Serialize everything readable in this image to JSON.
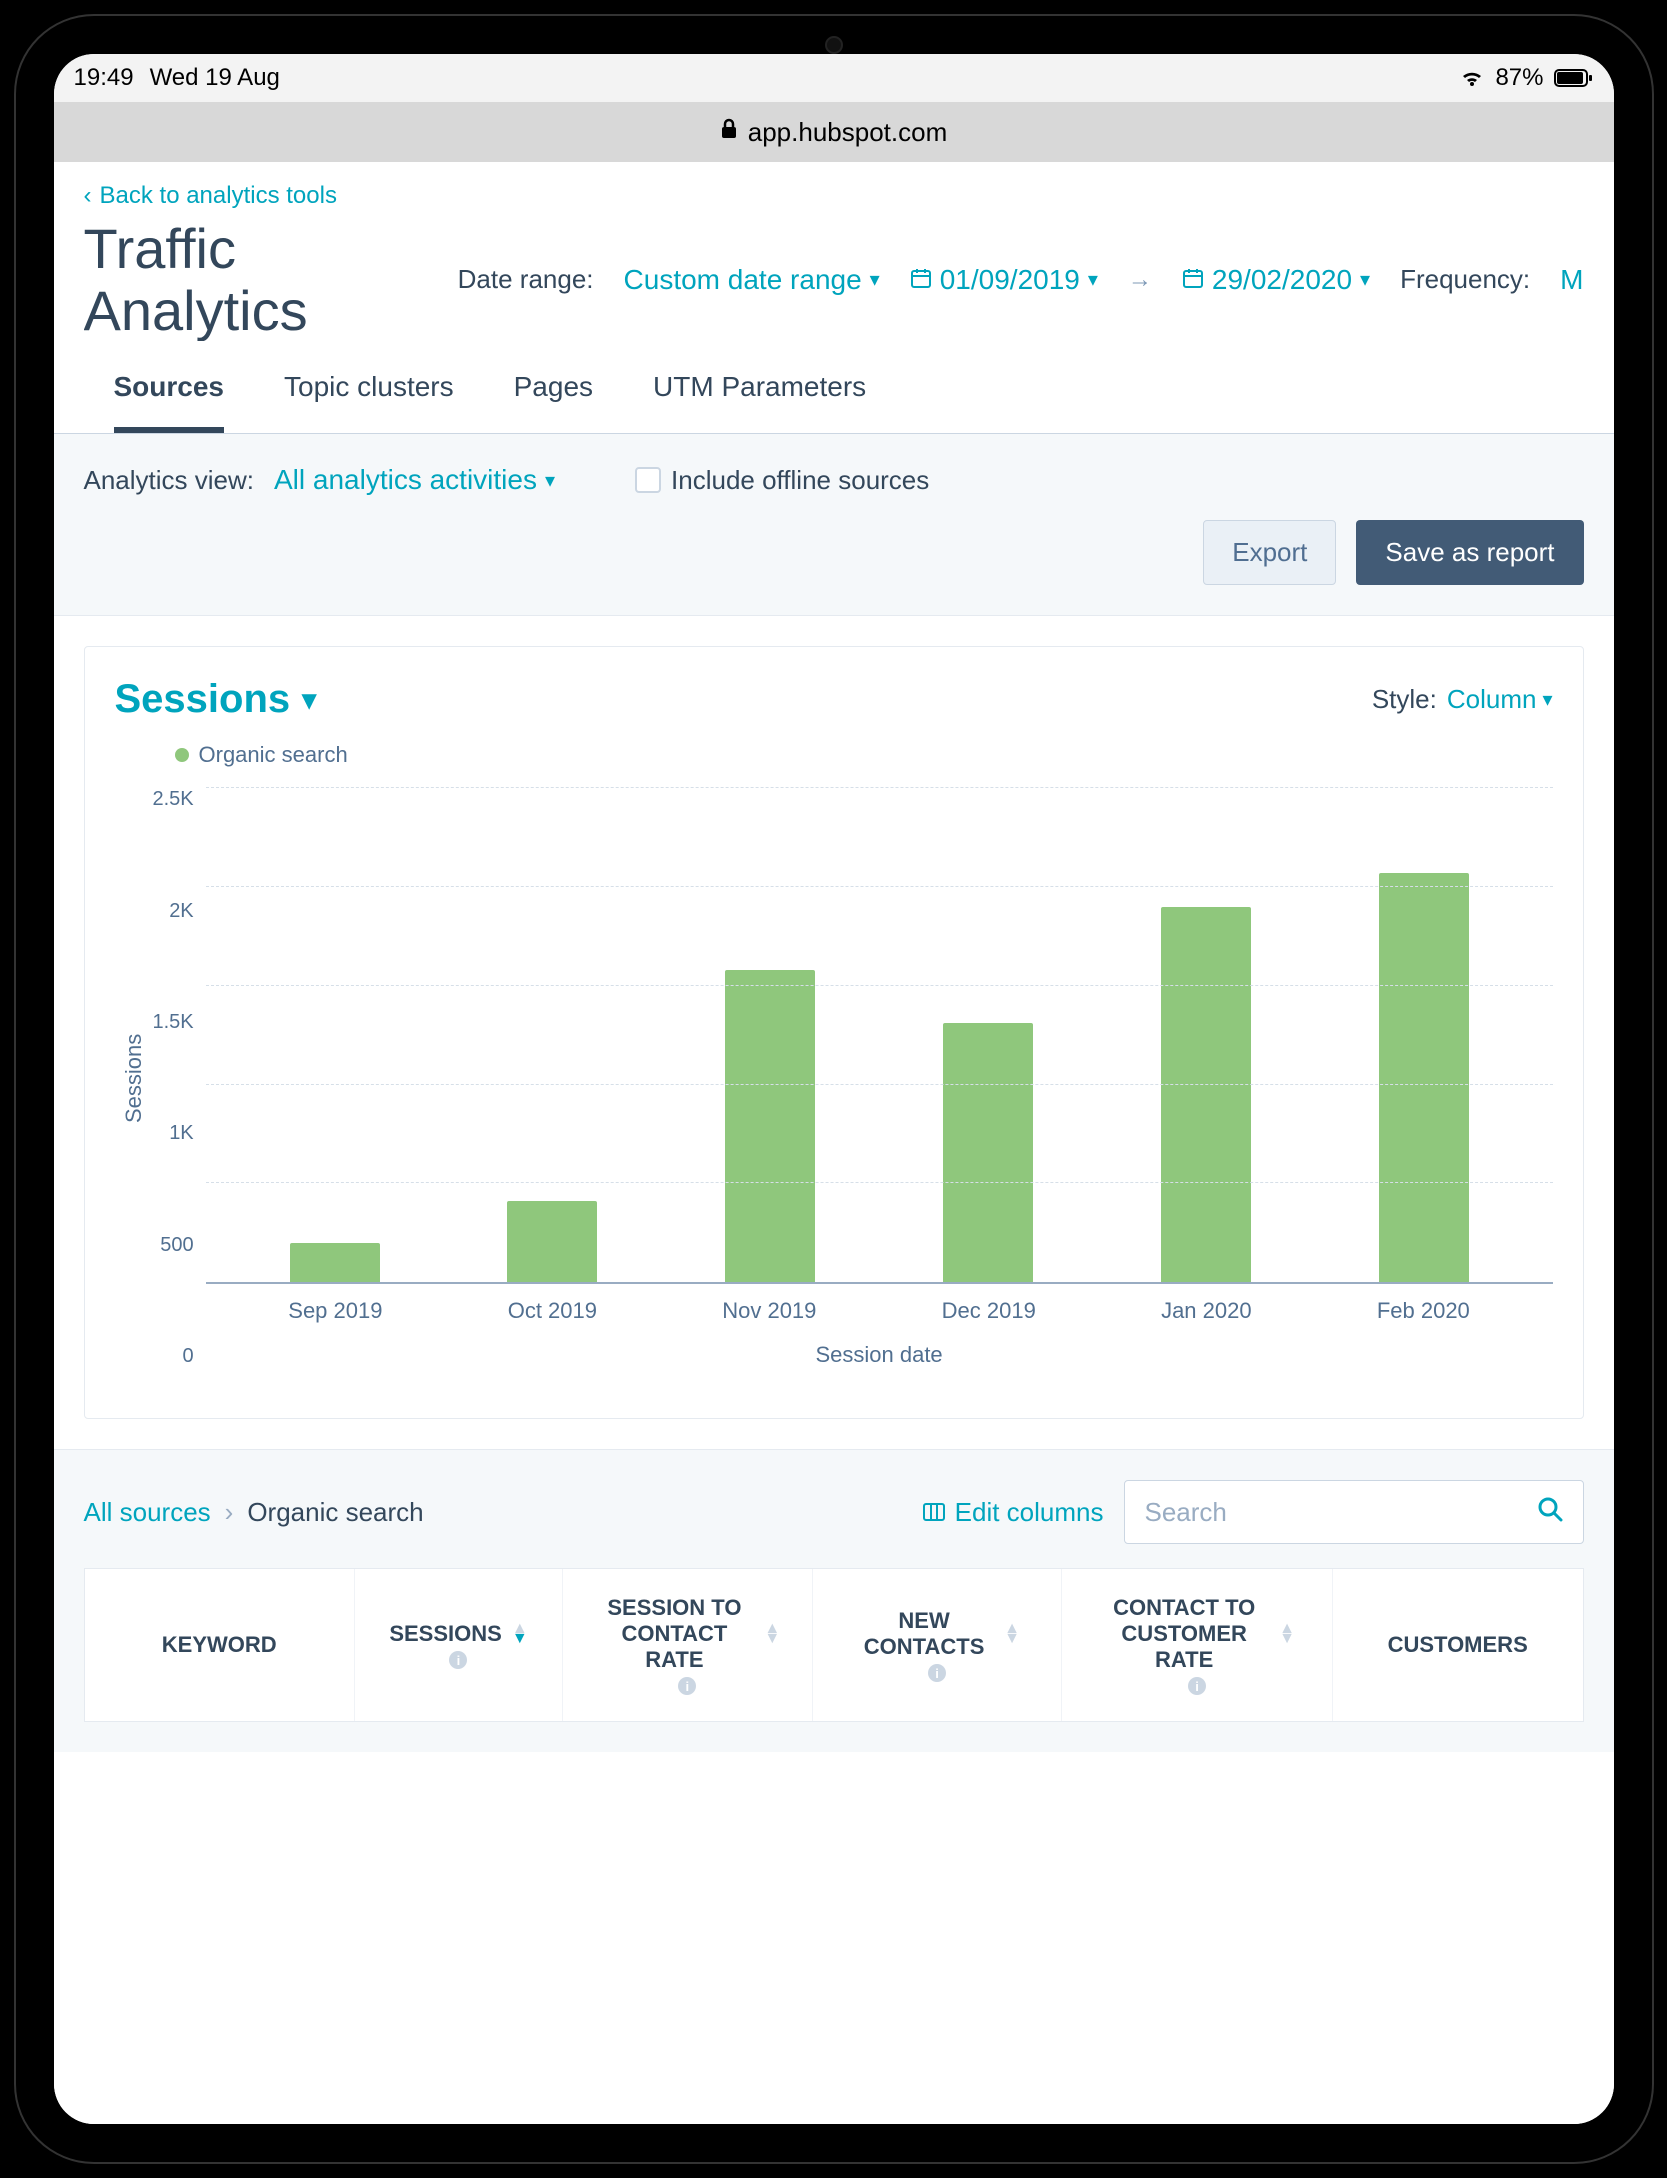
{
  "status_bar": {
    "time": "19:49",
    "date": "Wed 19 Aug",
    "battery": "87%"
  },
  "url_bar": {
    "host": "app.hubspot.com"
  },
  "back_link": "Back to analytics tools",
  "page_title": "Traffic Analytics",
  "filters": {
    "date_range_label": "Date range:",
    "date_range_value": "Custom date range",
    "date_start": "01/09/2019",
    "date_end": "29/02/2020",
    "frequency_label": "Frequency:",
    "frequency_value_partial": "M"
  },
  "tabs": [
    "Sources",
    "Topic clusters",
    "Pages",
    "UTM Parameters"
  ],
  "active_tab": "Sources",
  "controls": {
    "analytics_view_label": "Analytics view:",
    "analytics_view_value": "All analytics activities",
    "include_offline_label": "Include offline sources",
    "export_label": "Export",
    "save_label": "Save as report"
  },
  "chart": {
    "metric_title": "Sessions",
    "style_label": "Style:",
    "style_value": "Column",
    "legend_series": "Organic search",
    "series_color": "#8fc77c",
    "y_label": "Sessions",
    "x_label": "Session date"
  },
  "chart_data": {
    "type": "bar",
    "title": "Sessions",
    "xlabel": "Session date",
    "ylabel": "Sessions",
    "ylim": [
      0,
      2500
    ],
    "y_ticks": [
      "2.5K",
      "2K",
      "1.5K",
      "1K",
      "500",
      "0"
    ],
    "categories": [
      "Sep 2019",
      "Oct 2019",
      "Nov 2019",
      "Dec 2019",
      "Jan 2020",
      "Feb 2020"
    ],
    "series": [
      {
        "name": "Organic search",
        "color": "#8fc77c",
        "values": [
          200,
          410,
          1580,
          1310,
          1900,
          2070
        ]
      }
    ]
  },
  "table": {
    "breadcrumb_root": "All sources",
    "breadcrumb_current": "Organic search",
    "edit_columns": "Edit columns",
    "search_placeholder": "Search",
    "columns": [
      "KEYWORD",
      "SESSIONS",
      "SESSION TO CONTACT RATE",
      "NEW CONTACTS",
      "CONTACT TO CUSTOMER RATE",
      "CUSTOMERS"
    ]
  }
}
